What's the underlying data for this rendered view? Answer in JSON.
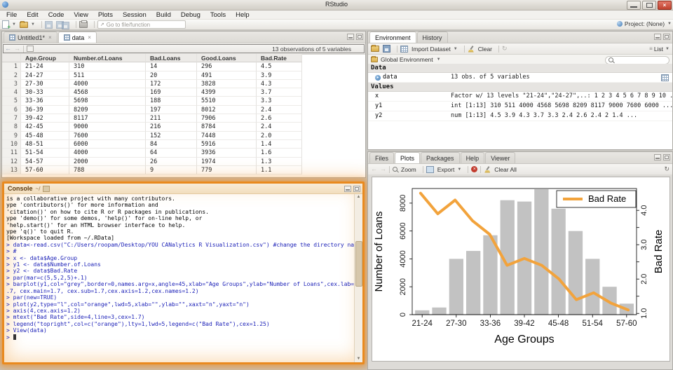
{
  "window": {
    "title": "RStudio"
  },
  "menubar": {
    "items": [
      "File",
      "Edit",
      "Code",
      "View",
      "Plots",
      "Session",
      "Build",
      "Debug",
      "Tools",
      "Help"
    ]
  },
  "toolbar": {
    "goto_placeholder": "Go to file/function",
    "project_label": "Project: (None)"
  },
  "source_pane": {
    "tabs": [
      {
        "label": "Untitled1*",
        "icon": "r-script-icon",
        "active": false
      },
      {
        "label": "data",
        "icon": "data-grid-icon",
        "active": true
      }
    ],
    "status": "13 observations of 5 variables",
    "table": {
      "columns": [
        "Age.Group",
        "Number.of.Loans",
        "Bad.Loans",
        "Good.Loans",
        "Bad.Rate"
      ],
      "rows": [
        [
          "1",
          "21-24",
          "310",
          "14",
          "296",
          "4.5"
        ],
        [
          "2",
          "24-27",
          "511",
          "20",
          "491",
          "3.9"
        ],
        [
          "3",
          "27-30",
          "4000",
          "172",
          "3828",
          "4.3"
        ],
        [
          "4",
          "30-33",
          "4568",
          "169",
          "4399",
          "3.7"
        ],
        [
          "5",
          "33-36",
          "5698",
          "188",
          "5510",
          "3.3"
        ],
        [
          "6",
          "36-39",
          "8209",
          "197",
          "8012",
          "2.4"
        ],
        [
          "7",
          "39-42",
          "8117",
          "211",
          "7906",
          "2.6"
        ],
        [
          "8",
          "42-45",
          "9000",
          "216",
          "8784",
          "2.4"
        ],
        [
          "9",
          "45-48",
          "7600",
          "152",
          "7448",
          "2.0"
        ],
        [
          "10",
          "48-51",
          "6000",
          "84",
          "5916",
          "1.4"
        ],
        [
          "11",
          "51-54",
          "4000",
          "64",
          "3936",
          "1.6"
        ],
        [
          "12",
          "54-57",
          "2000",
          "26",
          "1974",
          "1.3"
        ],
        [
          "13",
          "57-60",
          "788",
          "9",
          "779",
          "1.1"
        ]
      ]
    }
  },
  "console_pane": {
    "title": "Console",
    "path": "~/",
    "prompt": ">",
    "lines": [
      {
        "type": "output",
        "text": "is a collaborative project with many contributors."
      },
      {
        "type": "output",
        "text": "ype 'contributors()' for more information and"
      },
      {
        "type": "output",
        "text": "'citation()' on how to cite R or R packages in publications."
      },
      {
        "type": "output",
        "text": ""
      },
      {
        "type": "output",
        "text": "ype 'demo()' for some demos, 'help()' for on-line help, or"
      },
      {
        "type": "output",
        "text": "'help.start()' for an HTML browser interface to help."
      },
      {
        "type": "output",
        "text": "ype 'q()' to quit R."
      },
      {
        "type": "output",
        "text": ""
      },
      {
        "type": "output",
        "text": "[Workspace loaded from ~/.RData]"
      },
      {
        "type": "output",
        "text": ""
      },
      {
        "type": "input",
        "text": "data<-read.csv(\"C:/Users/roopam/Desktop/YOU CANalytics R Visualization.csv\") #change the directory nam"
      },
      {
        "type": "input",
        "text": "#"
      },
      {
        "type": "input",
        "text": "x <- data$Age.Group"
      },
      {
        "type": "input",
        "text": "y1 <- data$Number.of.Loans"
      },
      {
        "type": "input",
        "text": "y2 <- data$Bad.Rate"
      },
      {
        "type": "input",
        "text": "par(mar=c(5,5,2,5)+.1)"
      },
      {
        "type": "input",
        "text": "barplot(y1,col=\"grey\",border=0,names.arg=x,angle=45,xlab=\"Age Groups\",ylab=\"Number of Loans\",cex.lab=1"
      },
      {
        "type": "input-wrap",
        "text": ".7, cex.main=1.7, cex.sub=1.7,cex.axis=1.2,cex.names=1.2)"
      },
      {
        "type": "input",
        "text": "par(new=TRUE)"
      },
      {
        "type": "input",
        "text": "plot(y2,type=\"l\",col=\"orange\",lwd=5,xlab=\"\",ylab=\"\",xaxt=\"n\",yaxt=\"n\")"
      },
      {
        "type": "input",
        "text": "axis(4,cex.axis=1.2)"
      },
      {
        "type": "input",
        "text": "mtext(\"Bad Rate\",side=4,line=3,cex=1.7)"
      },
      {
        "type": "input",
        "text": "legend(\"topright\",col=c(\"orange\"),lty=1,lwd=5,legend=c(\"Bad Rate\"),cex=1.25)"
      },
      {
        "type": "input",
        "text": "View(data)"
      },
      {
        "type": "prompt",
        "text": ""
      }
    ]
  },
  "environment_pane": {
    "tabs": [
      "Environment",
      "History"
    ],
    "active_tab": "Environment",
    "toolbar": {
      "import_label": "Import Dataset",
      "clear_label": "Clear",
      "list_label": "List"
    },
    "scope_label": "Global Environment",
    "sections": [
      {
        "title": "Data",
        "items": [
          {
            "name": "data",
            "value": "13 obs. of 5 variables",
            "has_expander": true,
            "has_grid_button": true
          }
        ]
      },
      {
        "title": "Values",
        "items": [
          {
            "name": "x",
            "value": "Factor w/ 13 levels \"21-24\",\"24-27\",..: 1 2 3 4 5 6 7 8 9 10 ..."
          },
          {
            "name": "y1",
            "value": "int [1:13] 310 511 4000 4568 5698 8209 8117 9000 7600 6000 ..."
          },
          {
            "name": "y2",
            "value": "num [1:13] 4.5 3.9 4.3 3.7 3.3 2.4 2.6 2.4 2 1.4 ..."
          }
        ]
      }
    ]
  },
  "plots_pane": {
    "tabs": [
      "Files",
      "Plots",
      "Packages",
      "Help",
      "Viewer"
    ],
    "active_tab": "Plots",
    "toolbar": {
      "zoom_label": "Zoom",
      "export_label": "Export",
      "clear_all_label": "Clear All"
    }
  },
  "chart_data": {
    "type": "bar",
    "subtype": "bar-with-line-overlay-dual-axis",
    "categories": [
      "21-24",
      "24-27",
      "27-30",
      "30-33",
      "33-36",
      "36-39",
      "39-42",
      "42-45",
      "45-48",
      "48-51",
      "51-54",
      "54-57",
      "57-60"
    ],
    "series": [
      {
        "name": "Number of Loans",
        "type": "bar",
        "axis": "left",
        "color": "#c2c2c2",
        "values": [
          310,
          511,
          4000,
          4568,
          5698,
          8209,
          8117,
          9000,
          7600,
          6000,
          4000,
          2000,
          788
        ]
      },
      {
        "name": "Bad Rate",
        "type": "line",
        "axis": "right",
        "color": "#f2a33c",
        "values": [
          4.5,
          3.9,
          4.3,
          3.7,
          3.3,
          2.4,
          2.6,
          2.4,
          2.0,
          1.4,
          1.6,
          1.3,
          1.1
        ]
      }
    ],
    "xlabel": "Age Groups",
    "ylabel_left": "Number of Loans",
    "ylabel_right": "Bad Rate",
    "x_tick_labels": [
      "21-24",
      "27-30",
      "33-36",
      "39-42",
      "45-48",
      "51-54",
      "57-60"
    ],
    "left_ticks": [
      0,
      2000,
      4000,
      6000,
      8000
    ],
    "left_range": [
      0,
      9050
    ],
    "right_ticks": [
      1.0,
      2.0,
      3.0,
      4.0
    ],
    "right_minor_ticks": [
      1.5,
      2.5,
      3.5
    ],
    "right_range": [
      0.964,
      4.636
    ],
    "legend": {
      "label": "Bad Rate",
      "position": "topright"
    },
    "grid": false
  }
}
